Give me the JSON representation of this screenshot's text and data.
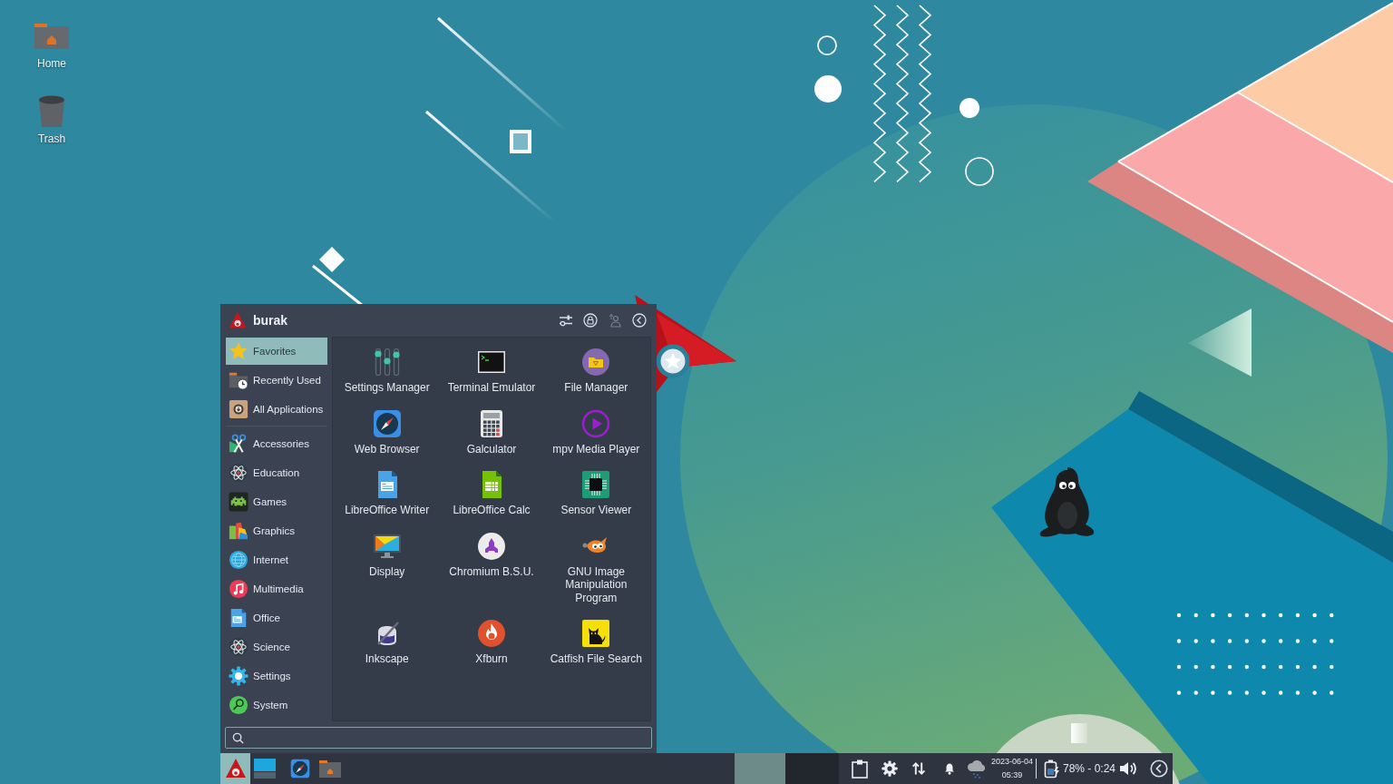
{
  "desktop_icons": [
    {
      "label": "Home"
    },
    {
      "label": "Trash"
    }
  ],
  "menu": {
    "user": "burak",
    "places": [
      {
        "label": "Favorites",
        "selected": true
      },
      {
        "label": "Recently Used",
        "selected": false
      },
      {
        "label": "All Applications",
        "selected": false
      }
    ],
    "categories": [
      {
        "label": "Accessories",
        "selected": false
      },
      {
        "label": "Education",
        "selected": false
      },
      {
        "label": "Games",
        "selected": false
      },
      {
        "label": "Graphics",
        "selected": false
      },
      {
        "label": "Internet",
        "selected": false
      },
      {
        "label": "Multimedia",
        "selected": false
      },
      {
        "label": "Office",
        "selected": false
      },
      {
        "label": "Science",
        "selected": false
      },
      {
        "label": "Settings",
        "selected": false
      },
      {
        "label": "System",
        "selected": false
      }
    ],
    "apps": [
      "Settings Manager",
      "Terminal Emulator",
      "File Manager",
      "Web Browser",
      "Galculator",
      "mpv Media Player",
      "LibreOffice Writer",
      "LibreOffice Calc",
      "Sensor Viewer",
      "Display",
      "Chromium B.S.U.",
      "GNU Image Manipulation Program",
      "Inkscape",
      "Xfburn",
      "Catfish File Search"
    ]
  },
  "taskbar": {
    "workspaces": [
      {
        "selected": true
      },
      {
        "selected": false
      }
    ],
    "date": "2023-06-04",
    "time": "05:39",
    "battery": "78% - 0:24"
  }
}
